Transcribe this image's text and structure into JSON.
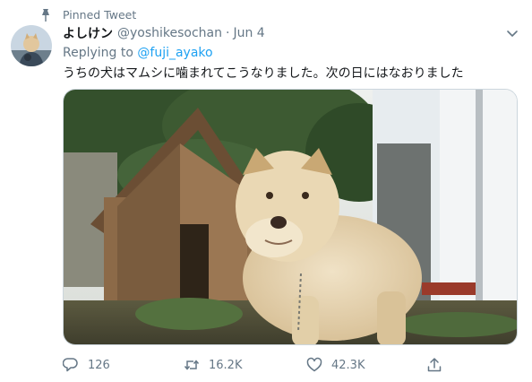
{
  "pinned": {
    "label": "Pinned Tweet"
  },
  "author": {
    "display_name": "よしけン",
    "handle": "@yoshikesochan",
    "separator": "·",
    "date": "Jun 4"
  },
  "reply": {
    "prefix": "Replying to",
    "mention": "@fuji_ayako"
  },
  "tweet": {
    "text": "うちの犬はマムシに噛まれてこうなりました。次の日にはなおりました"
  },
  "actions": {
    "replies": "126",
    "retweets": "16.2K",
    "likes": "42.3K"
  },
  "icons": {
    "pin": "pin-icon",
    "caret": "chevron-down-icon",
    "reply": "reply-icon",
    "retweet": "retweet-icon",
    "like": "heart-icon",
    "share": "share-icon"
  },
  "colors": {
    "accent": "#1da1f2",
    "secondary_text": "#657786",
    "primary_text": "#14171a"
  }
}
